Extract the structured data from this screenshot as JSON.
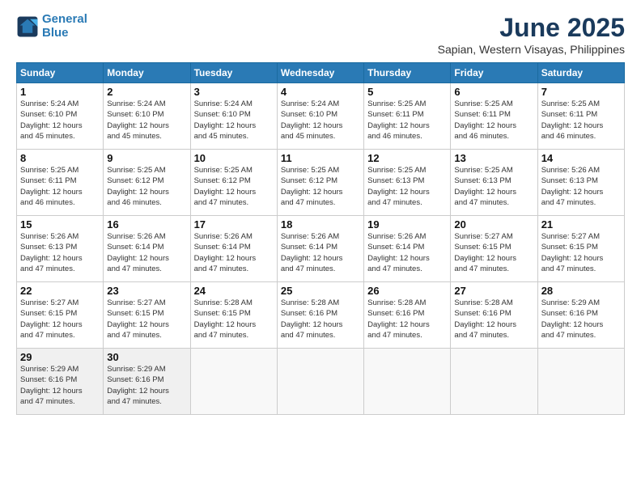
{
  "logo": {
    "line1": "General",
    "line2": "Blue"
  },
  "title": "June 2025",
  "subtitle": "Sapian, Western Visayas, Philippines",
  "weekdays": [
    "Sunday",
    "Monday",
    "Tuesday",
    "Wednesday",
    "Thursday",
    "Friday",
    "Saturday"
  ],
  "weeks": [
    [
      {
        "day": 1,
        "info": "Sunrise: 5:24 AM\nSunset: 6:10 PM\nDaylight: 12 hours\nand 45 minutes."
      },
      {
        "day": 2,
        "info": "Sunrise: 5:24 AM\nSunset: 6:10 PM\nDaylight: 12 hours\nand 45 minutes."
      },
      {
        "day": 3,
        "info": "Sunrise: 5:24 AM\nSunset: 6:10 PM\nDaylight: 12 hours\nand 45 minutes."
      },
      {
        "day": 4,
        "info": "Sunrise: 5:24 AM\nSunset: 6:10 PM\nDaylight: 12 hours\nand 45 minutes."
      },
      {
        "day": 5,
        "info": "Sunrise: 5:25 AM\nSunset: 6:11 PM\nDaylight: 12 hours\nand 46 minutes."
      },
      {
        "day": 6,
        "info": "Sunrise: 5:25 AM\nSunset: 6:11 PM\nDaylight: 12 hours\nand 46 minutes."
      },
      {
        "day": 7,
        "info": "Sunrise: 5:25 AM\nSunset: 6:11 PM\nDaylight: 12 hours\nand 46 minutes."
      }
    ],
    [
      {
        "day": 8,
        "info": "Sunrise: 5:25 AM\nSunset: 6:11 PM\nDaylight: 12 hours\nand 46 minutes."
      },
      {
        "day": 9,
        "info": "Sunrise: 5:25 AM\nSunset: 6:12 PM\nDaylight: 12 hours\nand 46 minutes."
      },
      {
        "day": 10,
        "info": "Sunrise: 5:25 AM\nSunset: 6:12 PM\nDaylight: 12 hours\nand 47 minutes."
      },
      {
        "day": 11,
        "info": "Sunrise: 5:25 AM\nSunset: 6:12 PM\nDaylight: 12 hours\nand 47 minutes."
      },
      {
        "day": 12,
        "info": "Sunrise: 5:25 AM\nSunset: 6:13 PM\nDaylight: 12 hours\nand 47 minutes."
      },
      {
        "day": 13,
        "info": "Sunrise: 5:25 AM\nSunset: 6:13 PM\nDaylight: 12 hours\nand 47 minutes."
      },
      {
        "day": 14,
        "info": "Sunrise: 5:26 AM\nSunset: 6:13 PM\nDaylight: 12 hours\nand 47 minutes."
      }
    ],
    [
      {
        "day": 15,
        "info": "Sunrise: 5:26 AM\nSunset: 6:13 PM\nDaylight: 12 hours\nand 47 minutes."
      },
      {
        "day": 16,
        "info": "Sunrise: 5:26 AM\nSunset: 6:14 PM\nDaylight: 12 hours\nand 47 minutes."
      },
      {
        "day": 17,
        "info": "Sunrise: 5:26 AM\nSunset: 6:14 PM\nDaylight: 12 hours\nand 47 minutes."
      },
      {
        "day": 18,
        "info": "Sunrise: 5:26 AM\nSunset: 6:14 PM\nDaylight: 12 hours\nand 47 minutes."
      },
      {
        "day": 19,
        "info": "Sunrise: 5:26 AM\nSunset: 6:14 PM\nDaylight: 12 hours\nand 47 minutes."
      },
      {
        "day": 20,
        "info": "Sunrise: 5:27 AM\nSunset: 6:15 PM\nDaylight: 12 hours\nand 47 minutes."
      },
      {
        "day": 21,
        "info": "Sunrise: 5:27 AM\nSunset: 6:15 PM\nDaylight: 12 hours\nand 47 minutes."
      }
    ],
    [
      {
        "day": 22,
        "info": "Sunrise: 5:27 AM\nSunset: 6:15 PM\nDaylight: 12 hours\nand 47 minutes."
      },
      {
        "day": 23,
        "info": "Sunrise: 5:27 AM\nSunset: 6:15 PM\nDaylight: 12 hours\nand 47 minutes."
      },
      {
        "day": 24,
        "info": "Sunrise: 5:28 AM\nSunset: 6:15 PM\nDaylight: 12 hours\nand 47 minutes."
      },
      {
        "day": 25,
        "info": "Sunrise: 5:28 AM\nSunset: 6:16 PM\nDaylight: 12 hours\nand 47 minutes."
      },
      {
        "day": 26,
        "info": "Sunrise: 5:28 AM\nSunset: 6:16 PM\nDaylight: 12 hours\nand 47 minutes."
      },
      {
        "day": 27,
        "info": "Sunrise: 5:28 AM\nSunset: 6:16 PM\nDaylight: 12 hours\nand 47 minutes."
      },
      {
        "day": 28,
        "info": "Sunrise: 5:29 AM\nSunset: 6:16 PM\nDaylight: 12 hours\nand 47 minutes."
      }
    ],
    [
      {
        "day": 29,
        "info": "Sunrise: 5:29 AM\nSunset: 6:16 PM\nDaylight: 12 hours\nand 47 minutes."
      },
      {
        "day": 30,
        "info": "Sunrise: 5:29 AM\nSunset: 6:16 PM\nDaylight: 12 hours\nand 47 minutes."
      },
      {
        "day": null,
        "info": ""
      },
      {
        "day": null,
        "info": ""
      },
      {
        "day": null,
        "info": ""
      },
      {
        "day": null,
        "info": ""
      },
      {
        "day": null,
        "info": ""
      }
    ]
  ]
}
